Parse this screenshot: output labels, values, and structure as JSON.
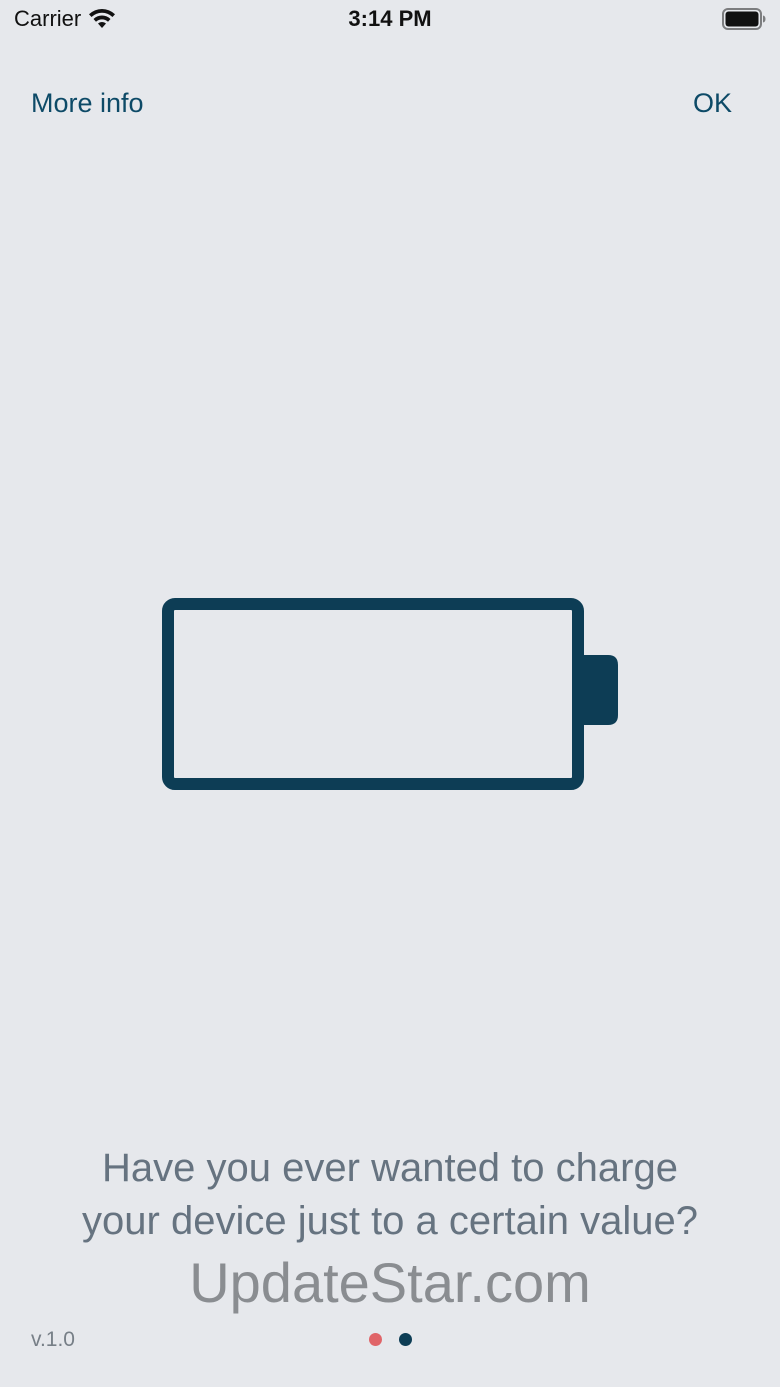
{
  "status_bar": {
    "carrier": "Carrier",
    "time": "3:14 PM",
    "wifi_icon": "wifi-icon",
    "battery_icon": "battery-full-icon"
  },
  "nav": {
    "more_info_label": "More info",
    "ok_label": "OK"
  },
  "illustration": {
    "icon": "battery-empty-icon",
    "color": "#0d3d55"
  },
  "onboarding": {
    "headline_line1": "Have you ever wanted to charge",
    "headline_line2": "your device just to a certain value?",
    "watermark": "UpdateStar.com",
    "version": "v.1.0",
    "page_indicator": {
      "pages": 2,
      "current": 1,
      "active_color": "#0d3d55",
      "inactive_color": "#e06468"
    }
  },
  "colors": {
    "background": "#e6e8ec",
    "accent": "#0d4a67",
    "headline_text": "#667380"
  }
}
